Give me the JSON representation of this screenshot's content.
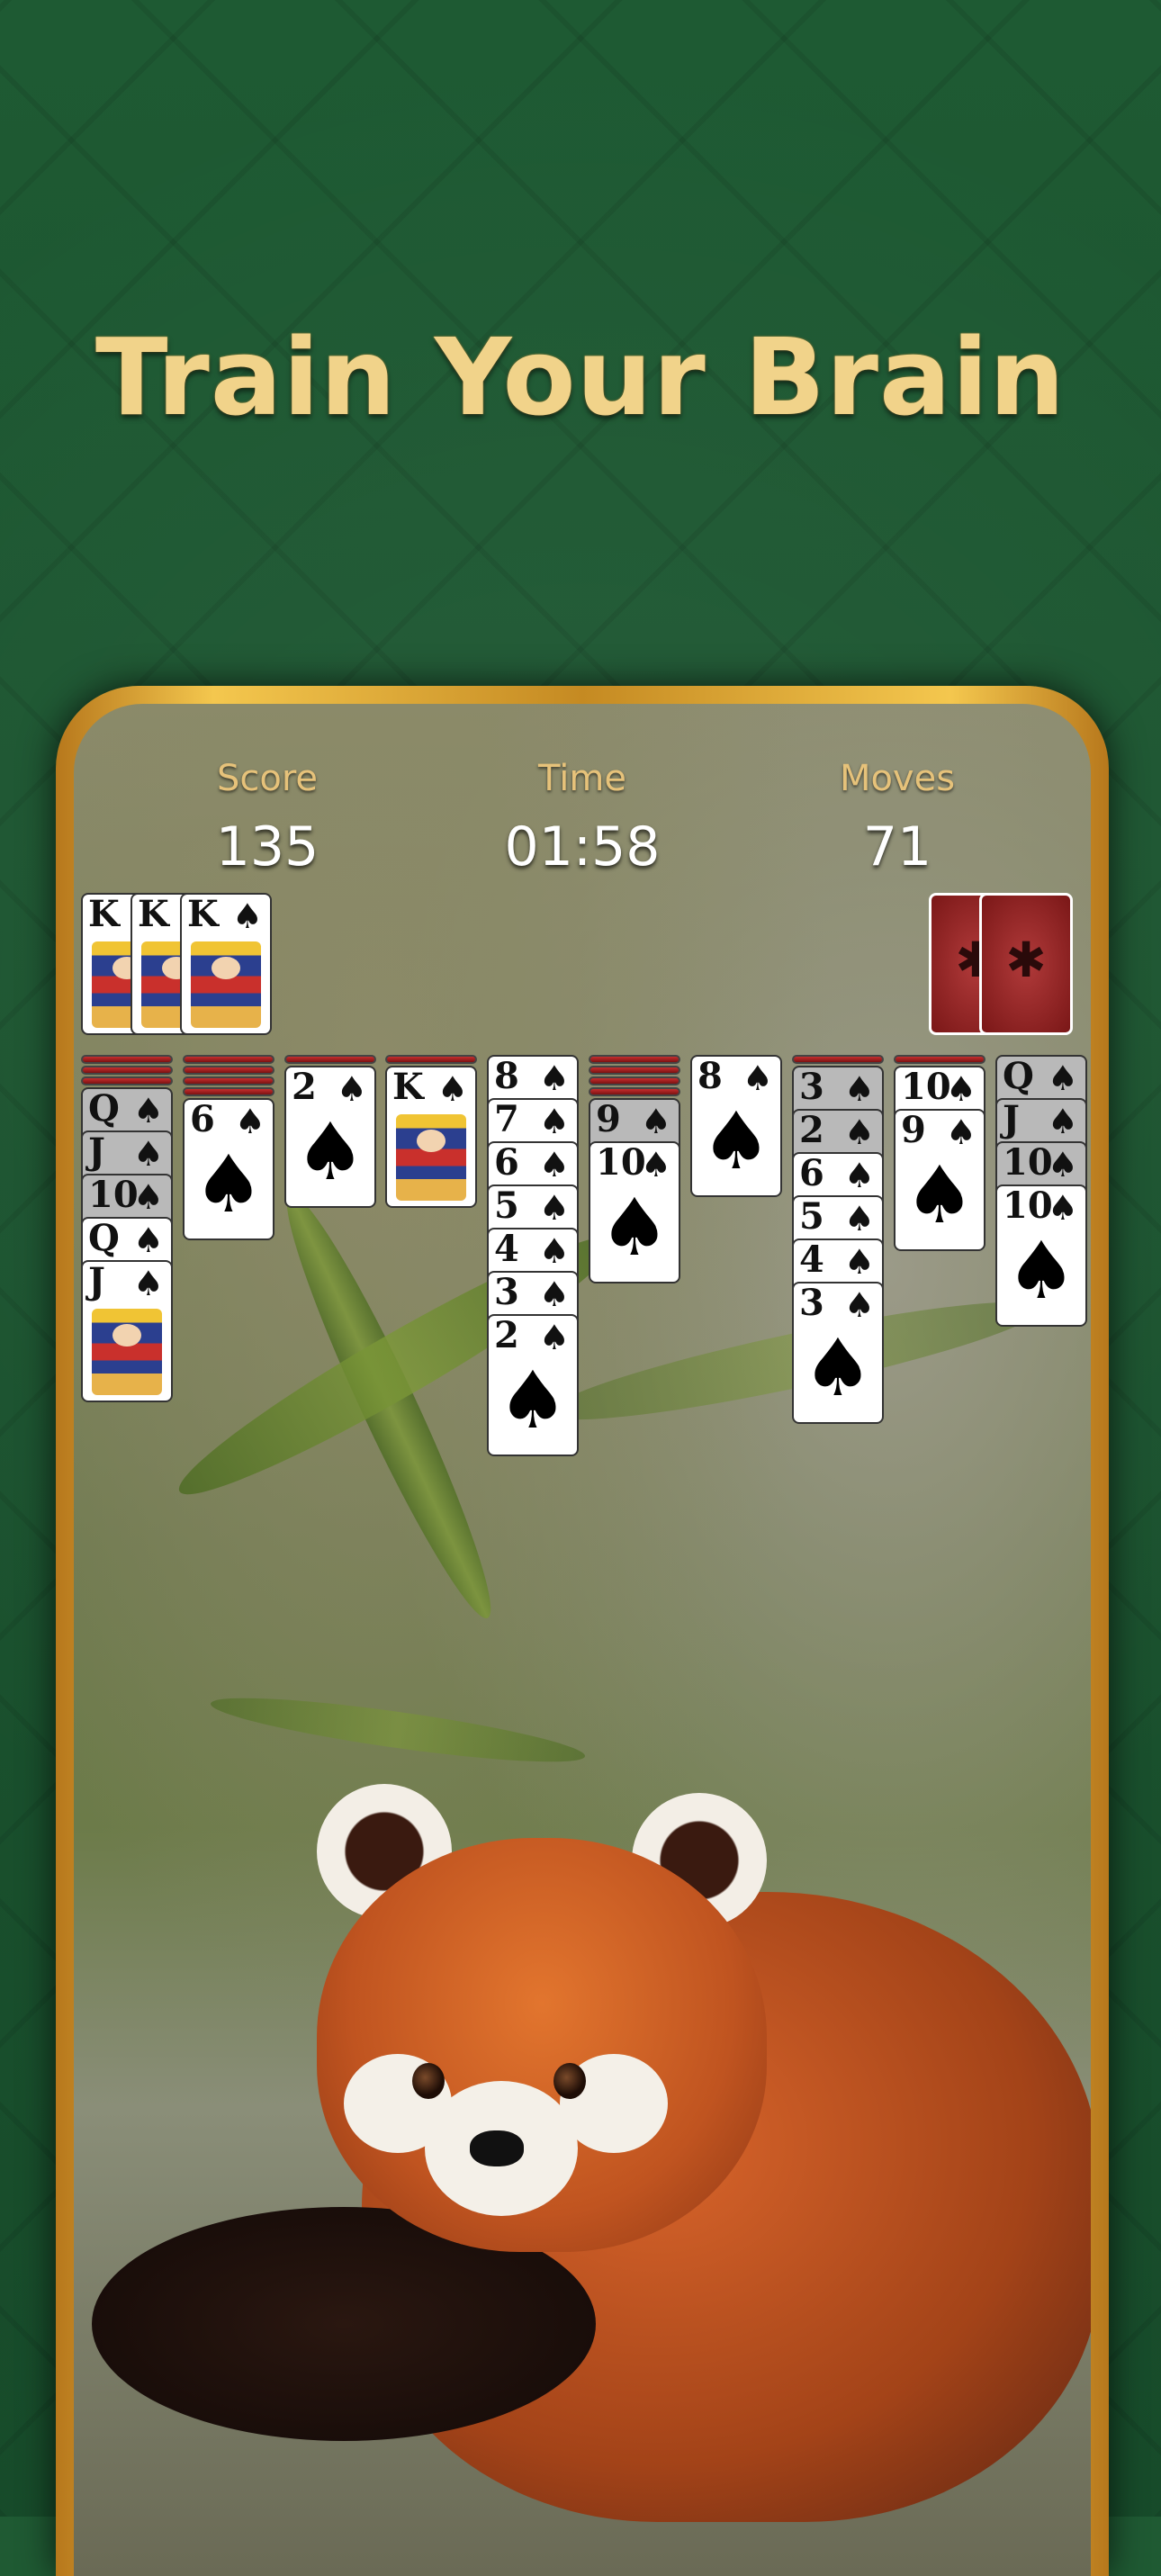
{
  "headline": "Train Your Brain",
  "hud": {
    "score_label": "Score",
    "score_value": "135",
    "time_label": "Time",
    "time_value": "01:58",
    "moves_label": "Moves",
    "moves_value": "71"
  },
  "completed_foundations": [
    "K",
    "K",
    "K"
  ],
  "suit": "♠",
  "stock_icon": "spider-icon",
  "columns": [
    {
      "face_down": 3,
      "cards": [
        [
          "Q",
          true
        ],
        [
          "J",
          true
        ],
        [
          "10",
          true
        ],
        [
          "Q",
          false
        ],
        [
          "J",
          false
        ]
      ]
    },
    {
      "face_down": 4,
      "cards": [
        [
          "6",
          false
        ]
      ]
    },
    {
      "face_down": 1,
      "cards": [
        [
          "2",
          false
        ]
      ]
    },
    {
      "face_down": 1,
      "cards": [
        [
          "K",
          false
        ]
      ]
    },
    {
      "face_down": 0,
      "cards": [
        [
          "8",
          false
        ],
        [
          "7",
          false
        ],
        [
          "6",
          false
        ],
        [
          "5",
          false
        ],
        [
          "4",
          false
        ],
        [
          "3",
          false
        ],
        [
          "2",
          false
        ]
      ]
    },
    {
      "face_down": 4,
      "cards": [
        [
          "9",
          true
        ],
        [
          "10",
          false
        ]
      ]
    },
    {
      "face_down": 0,
      "cards": [
        [
          "8",
          false
        ]
      ]
    },
    {
      "face_down": 1,
      "cards": [
        [
          "3",
          true
        ],
        [
          "2",
          true
        ],
        [
          "6",
          false
        ],
        [
          "5",
          false
        ],
        [
          "4",
          false
        ],
        [
          "3",
          false
        ]
      ]
    },
    {
      "face_down": 1,
      "cards": [
        [
          "10",
          false
        ],
        [
          "9",
          false
        ]
      ]
    },
    {
      "face_down": 0,
      "cards": [
        [
          "Q",
          true
        ],
        [
          "J",
          true
        ],
        [
          "10",
          true
        ],
        [
          "10",
          false
        ]
      ]
    }
  ],
  "colors": {
    "gold_text": "#f1d38a",
    "felt": "#1f5a33",
    "card_back": "#b13a3a"
  }
}
